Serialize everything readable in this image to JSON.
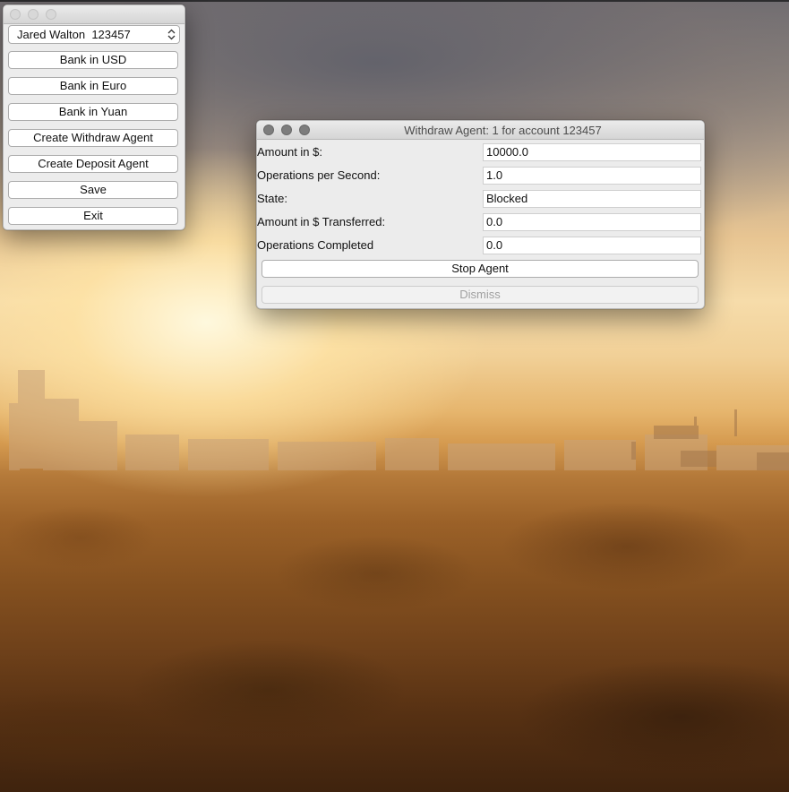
{
  "main_window": {
    "account_select": {
      "selected": "Jared Walton  123457"
    },
    "buttons": {
      "bank_usd": "Bank in USD",
      "bank_euro": "Bank in Euro",
      "bank_yuan": "Bank in Yuan",
      "create_withdraw_agent": "Create Withdraw Agent",
      "create_deposit_agent": "Create Deposit Agent",
      "save": "Save",
      "exit": "Exit"
    }
  },
  "agent_window": {
    "title": "Withdraw Agent: 1 for account 123457",
    "fields": {
      "amount_label": "Amount in $:",
      "amount_value": "10000.0",
      "ops_per_second_label": "Operations per Second:",
      "ops_per_second_value": "1.0",
      "state_label": "State:",
      "state_value": "Blocked",
      "amount_transferred_label": "Amount in $ Transferred:",
      "amount_transferred_value": "0.0",
      "ops_completed_label": "Operations Completed",
      "ops_completed_value": "0.0"
    },
    "buttons": {
      "stop_agent": "Stop Agent",
      "dismiss": "Dismiss"
    }
  }
}
